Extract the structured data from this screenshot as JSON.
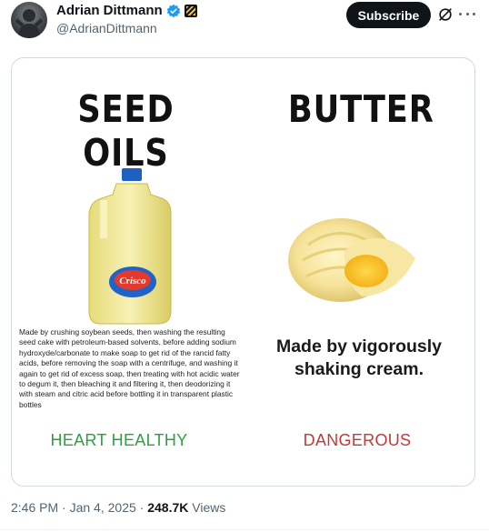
{
  "header": {
    "display_name": "Adrian Dittmann",
    "handle": "@AdrianDittmann",
    "subscribe_label": "Subscribe",
    "verified_icon": "verified-badge-icon",
    "affiliation_icon": "affiliation-badge-icon"
  },
  "meme": {
    "left_title": "SEED OILS",
    "right_title": "BUTTER",
    "left_description": "Made by crushing soybean seeds, then washing the resulting seed cake with petroleum-based solvents, before adding sodium hydroxyde/carbonate to make soap to get rid of the rancid fatty acids, before removing the soap with a centrifuge, and washing it again to get rid of excess soap, then treating with hot acidic water to degum it, then bleaching it and filtering it, then deodorizing it with steam and citric acid before bottling it in transparent plastic bottles",
    "right_description": "Made by vigorously shaking cream.",
    "left_label": "HEART HEALTHY",
    "right_label": "DANGEROUS",
    "bottle_brand": "Crisco",
    "left_label_color": "#2ea043",
    "right_label_color": "#c03a3a"
  },
  "footer": {
    "time": "2:46 PM",
    "separator": "·",
    "date": "Jan 4, 2025",
    "views_count": "248.7K",
    "views_label": "Views"
  }
}
